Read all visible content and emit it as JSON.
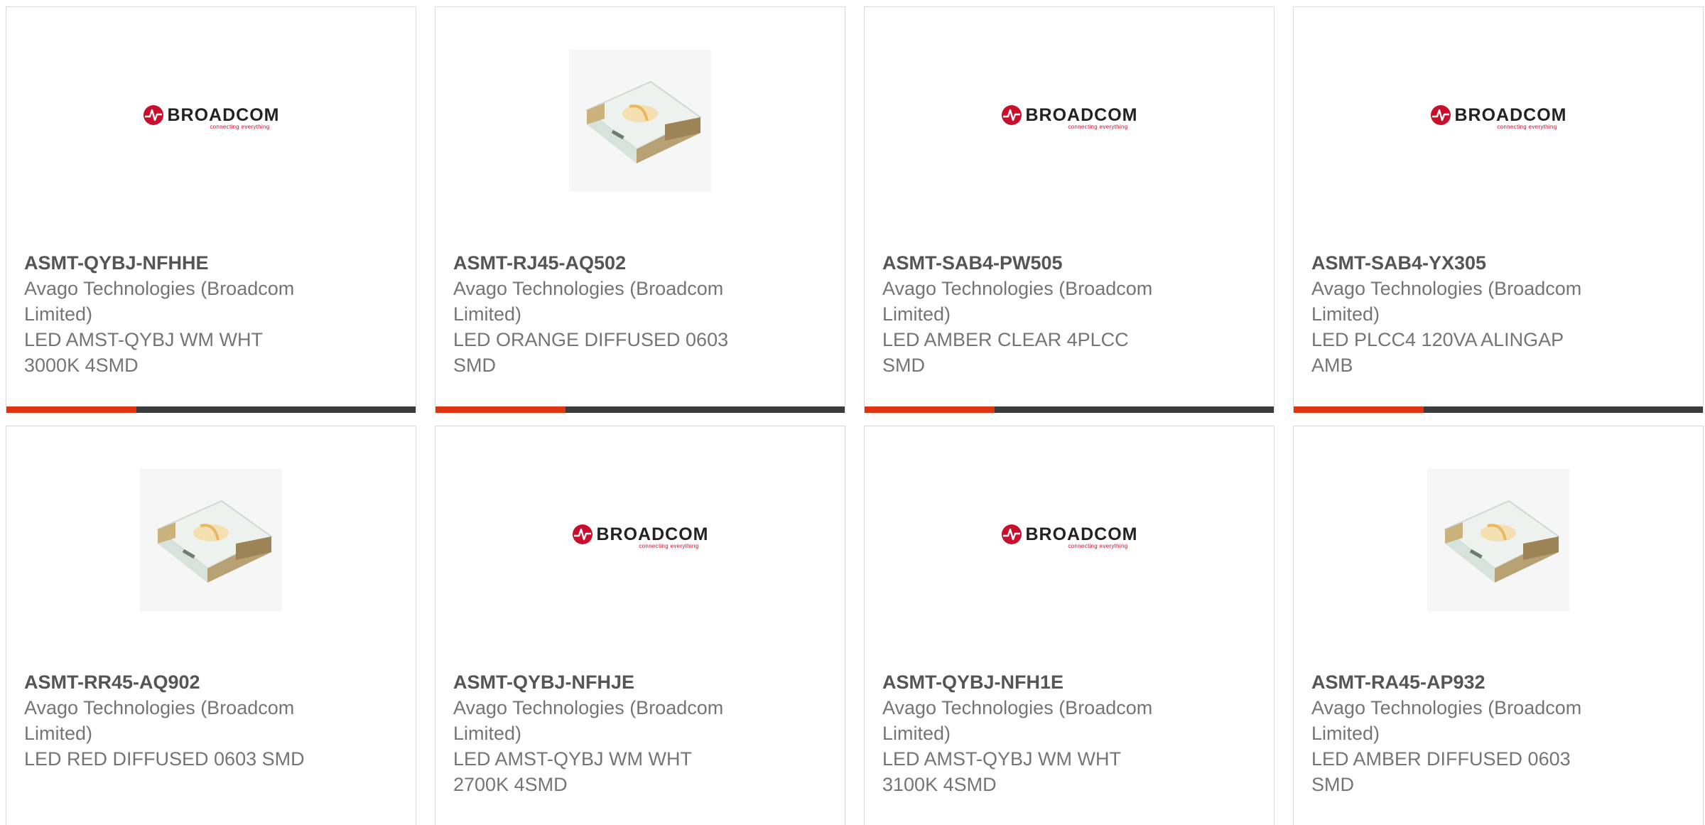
{
  "colors": {
    "accent": "#e0330f",
    "bar": "#3b3b3b",
    "border": "#d9d9d9",
    "brand_red": "#c8102e"
  },
  "logo": {
    "wordmark": "BROADCOM",
    "tagline": "connecting everything"
  },
  "products": [
    {
      "part_number": "ASMT-QYBJ-NFHHE",
      "manufacturer": [
        "Avago Technologies (Broadcom",
        "Limited)"
      ],
      "description": [
        "LED AMST-QYBJ WM WHT",
        "3000K 4SMD"
      ],
      "image": "broadcom-logo"
    },
    {
      "part_number": "ASMT-RJ45-AQ502",
      "manufacturer": [
        "Avago Technologies (Broadcom",
        "Limited)"
      ],
      "description": [
        "LED ORANGE DIFFUSED 0603",
        "SMD"
      ],
      "image": "smd-led-photo"
    },
    {
      "part_number": "ASMT-SAB4-PW505",
      "manufacturer": [
        "Avago Technologies (Broadcom",
        "Limited)"
      ],
      "description": [
        "LED AMBER CLEAR 4PLCC",
        "SMD"
      ],
      "image": "broadcom-logo"
    },
    {
      "part_number": "ASMT-SAB4-YX305",
      "manufacturer": [
        "Avago Technologies (Broadcom",
        "Limited)"
      ],
      "description": [
        "LED PLCC4 120VA ALINGAP",
        "AMB"
      ],
      "image": "broadcom-logo"
    },
    {
      "part_number": "ASMT-RR45-AQ902",
      "manufacturer": [
        "Avago Technologies (Broadcom",
        "Limited)"
      ],
      "description": [
        "LED RED DIFFUSED 0603 SMD",
        ""
      ],
      "image": "smd-led-photo"
    },
    {
      "part_number": "ASMT-QYBJ-NFHJE",
      "manufacturer": [
        "Avago Technologies (Broadcom",
        "Limited)"
      ],
      "description": [
        "LED AMST-QYBJ WM WHT",
        "2700K 4SMD"
      ],
      "image": "broadcom-logo"
    },
    {
      "part_number": "ASMT-QYBJ-NFH1E",
      "manufacturer": [
        "Avago Technologies (Broadcom",
        "Limited)"
      ],
      "description": [
        "LED AMST-QYBJ WM WHT",
        "3100K 4SMD"
      ],
      "image": "broadcom-logo"
    },
    {
      "part_number": "ASMT-RA45-AP932",
      "manufacturer": [
        "Avago Technologies (Broadcom",
        "Limited)"
      ],
      "description": [
        "LED AMBER DIFFUSED 0603",
        "SMD"
      ],
      "image": "smd-led-photo"
    }
  ]
}
